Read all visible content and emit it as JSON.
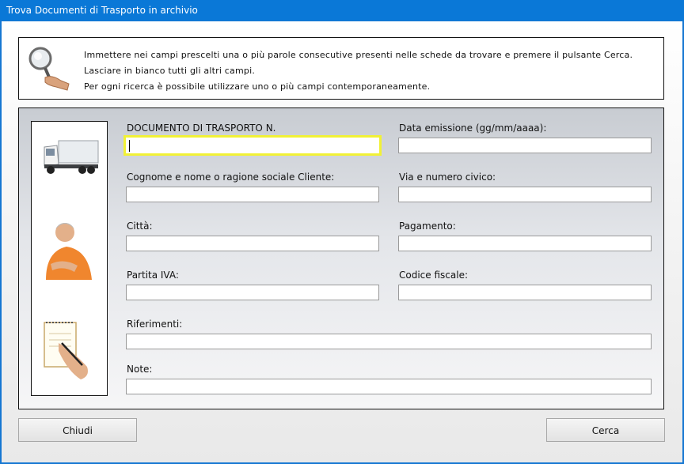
{
  "window": {
    "title": "Trova Documenti di Trasporto in archivio"
  },
  "info": {
    "line1": "Immettere nei campi prescelti una o più parole consecutive presenti nelle schede da trovare e premere il pulsante Cerca.",
    "line2": "Lasciare in bianco tutti gli altri campi.",
    "line3": "Per ogni ricerca è possibile utilizzare uno o più campi contemporaneamente."
  },
  "form": {
    "documento_label": "DOCUMENTO DI TRASPORTO N.",
    "documento_value": "",
    "data_label": "Data emissione (gg/mm/aaaa):",
    "data_value": "",
    "cliente_label": "Cognome e nome o ragione sociale Cliente:",
    "cliente_value": "",
    "via_label": "Via e numero civico:",
    "via_value": "",
    "citta_label": "Città:",
    "citta_value": "",
    "pagamento_label": "Pagamento:",
    "pagamento_value": "",
    "piva_label": "Partita IVA:",
    "piva_value": "",
    "codfisc_label": "Codice fiscale:",
    "codfisc_value": "",
    "riferimenti_label": "Riferimenti:",
    "riferimenti_value": "",
    "note_label": "Note:",
    "note_value": ""
  },
  "buttons": {
    "close": "Chiudi",
    "search": "Cerca"
  },
  "colors": {
    "titlebar": "#0a78d7",
    "focus": "#f1f135"
  },
  "icons": [
    "magnifier-hand-icon",
    "truck-icon",
    "person-icon",
    "notepad-writing-icon"
  ]
}
